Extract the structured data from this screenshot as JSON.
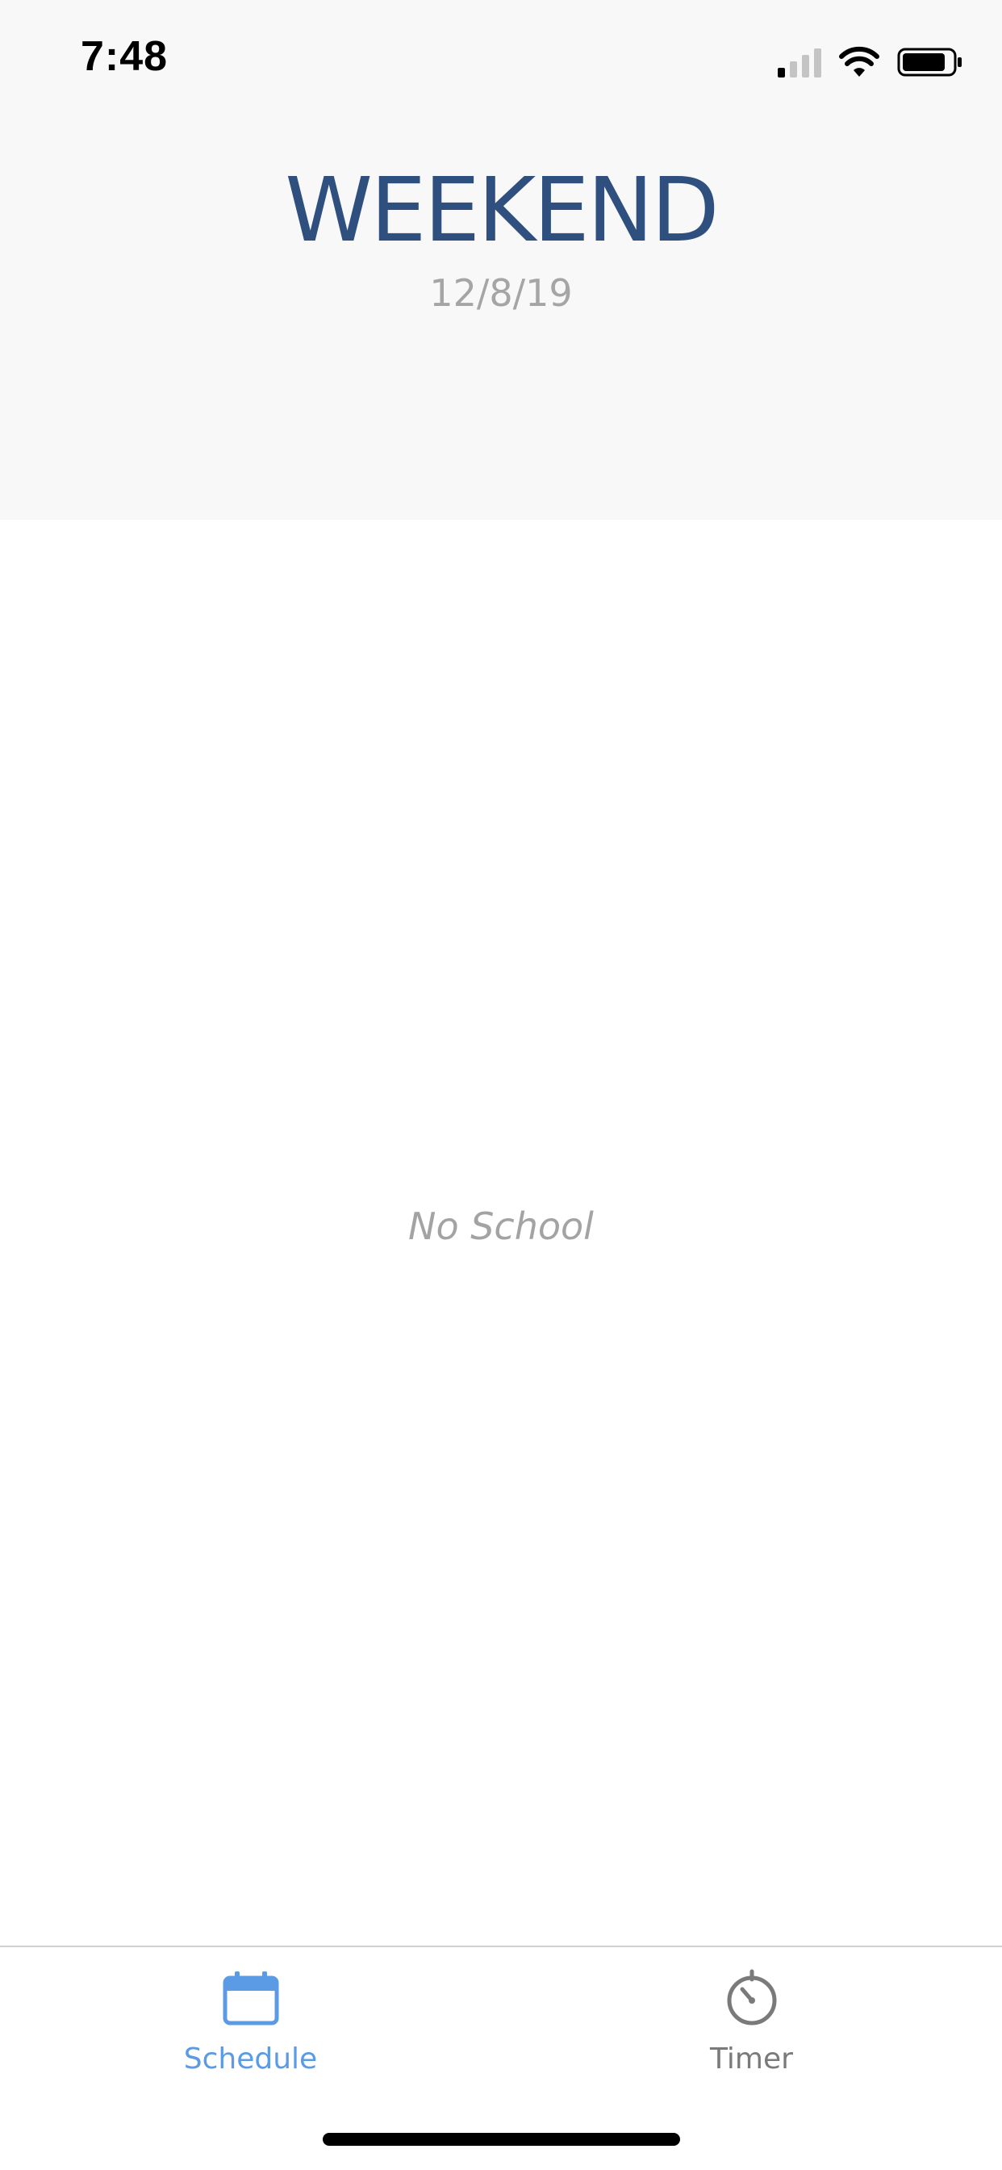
{
  "status_bar": {
    "time": "7:48",
    "signal_icon": "cellular-signal-icon",
    "signal_bars_active": 1,
    "signal_bars_total": 4,
    "wifi_icon": "wifi-icon",
    "battery_icon": "battery-icon",
    "battery_level": 0.8
  },
  "header": {
    "title": "WEEKEND",
    "date": "12/8/19"
  },
  "main": {
    "empty_message": "No School"
  },
  "tab_bar": {
    "tabs": [
      {
        "label": "Schedule",
        "icon": "calendar-icon",
        "selected": true
      },
      {
        "label": "Timer",
        "icon": "timer-icon",
        "selected": false
      }
    ]
  },
  "colors": {
    "header_background": "#f9f8f8",
    "title": "#2f4f7f",
    "date": "#a5a5a5",
    "accent": "#5b9be6",
    "tab_inactive": "#7a7a7a"
  }
}
